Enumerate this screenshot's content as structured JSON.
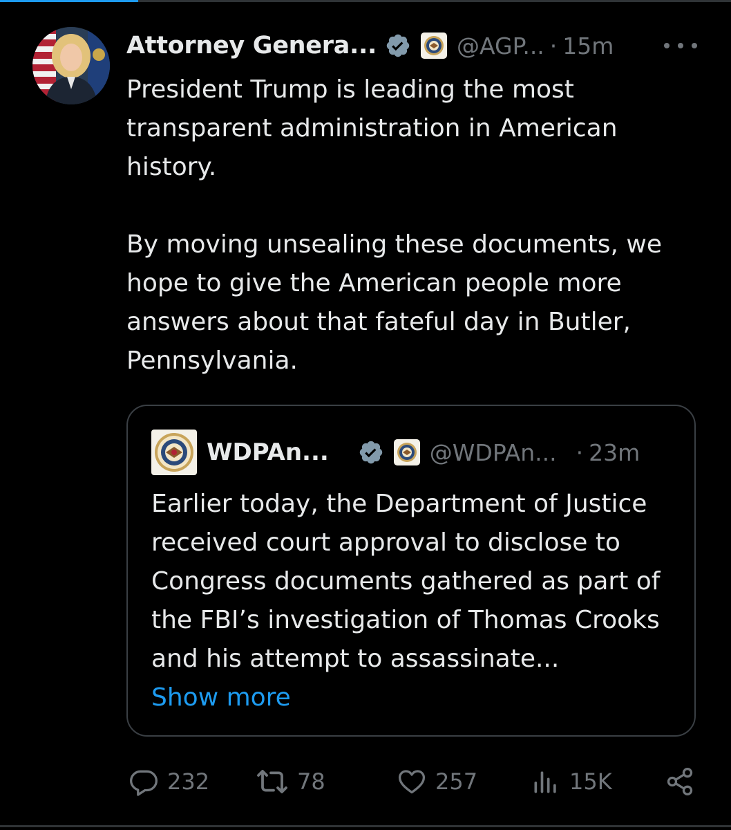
{
  "tweet": {
    "author_name": "Attorney Genera...",
    "handle": "@AGP...",
    "separator": "·",
    "time": "15m",
    "paragraphs": [
      "President Trump is leading the most transparent administration in American history.",
      "By moving unsealing these documents, we hope to give the American people more answers about that fateful day in Butler, Pennsylvania."
    ]
  },
  "quoted": {
    "author_name": "WDPAn...",
    "handle": "@WDPAn...",
    "separator": "·",
    "time": "23m",
    "text": "Earlier today, the Department of Justice received court approval to disclose to Congress documents gathered as part of the FBI’s investigation of Thomas Crooks and his attempt to assassinate...",
    "show_more": "Show more"
  },
  "actions": {
    "replies": "232",
    "reposts": "78",
    "likes": "257",
    "views": "15K"
  },
  "colors": {
    "background": "#000000",
    "text": "#e7e9ea",
    "muted": "#71767b",
    "link": "#1d9bf0",
    "verified_badge": "#829aab"
  }
}
